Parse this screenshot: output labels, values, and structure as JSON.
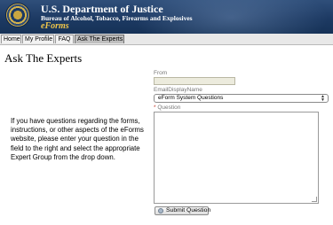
{
  "header": {
    "department": "U.S. Department of Justice",
    "bureau": "Bureau of Alcohol, Tobacco, Firearms and Explosives",
    "app_name": "eForms"
  },
  "nav": {
    "tabs": [
      {
        "label": "Home",
        "active": false
      },
      {
        "label": "My Profile",
        "active": false
      },
      {
        "label": "FAQ",
        "active": false
      },
      {
        "label": "Ask The Experts",
        "active": true
      }
    ]
  },
  "page": {
    "title": "Ask The Experts",
    "intro": "If you have questions regarding the forms, instructions, or other aspects of the eForms website, please enter your question in the field to the right and select the appropriate Expert Group from the drop down."
  },
  "form": {
    "from_label": "From",
    "from_value": "",
    "email_label": "EmailDisplayName",
    "email_selected": "eForm System Questions",
    "question_required_marker": "*",
    "question_label": "Question",
    "question_value": "",
    "submit_label": "Submit Question"
  },
  "colors": {
    "header_bg": "#1d3a63",
    "eforms_gold": "#f0c64a",
    "active_tab": "#bfbfbf",
    "from_field_bg": "#ecebdd"
  }
}
